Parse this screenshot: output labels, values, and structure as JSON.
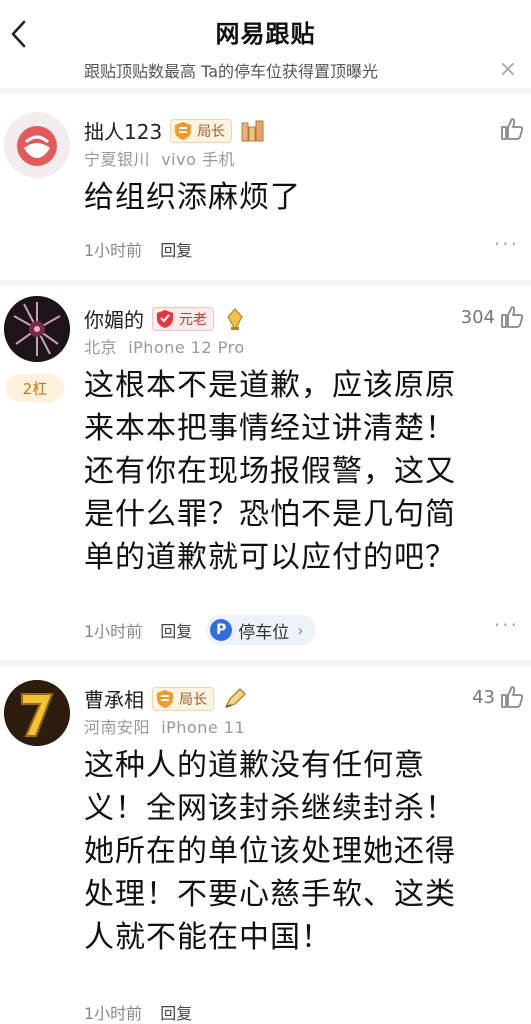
{
  "header": {
    "title": "网易跟贴"
  },
  "notice": {
    "text": "跟贴顶贴数最高 Ta的停车位获得置顶曝光",
    "close": "×"
  },
  "comments": [
    {
      "username": "拙人123",
      "badge": "局长",
      "location": "宁夏银川",
      "device": "vivo 手机",
      "likes": "",
      "text": "给组织添麻烦了",
      "time": "1小时前",
      "reply": "回复"
    },
    {
      "username": "你媚的",
      "badge": "元老",
      "location": "北京",
      "device": "iPhone 12 Pro",
      "likes": "304",
      "floor": "2杠",
      "text_lines": [
        "这根本不是道歉，应该原原",
        "来本本把事情经过讲清楚！",
        "还有你在现场报假警，这又",
        "是什么罪？恐怕不是几句简",
        "单的道歉就可以应付的吧？"
      ],
      "time": "1小时前",
      "reply": "回复",
      "parking": "停车位",
      "parking_icon": "P"
    },
    {
      "username": "曹承相",
      "badge": "局长",
      "location": "河南安阳",
      "device": "iPhone 11",
      "likes": "43",
      "text_lines": [
        "这种人的道歉没有任何意",
        "义！全网该封杀继续封杀！",
        "她所在的单位该处理她还得",
        "处理！不要心慈手软、这类",
        "人就不能在中国！"
      ],
      "time": "1小时前",
      "reply": "回复"
    }
  ],
  "more_label": "···"
}
